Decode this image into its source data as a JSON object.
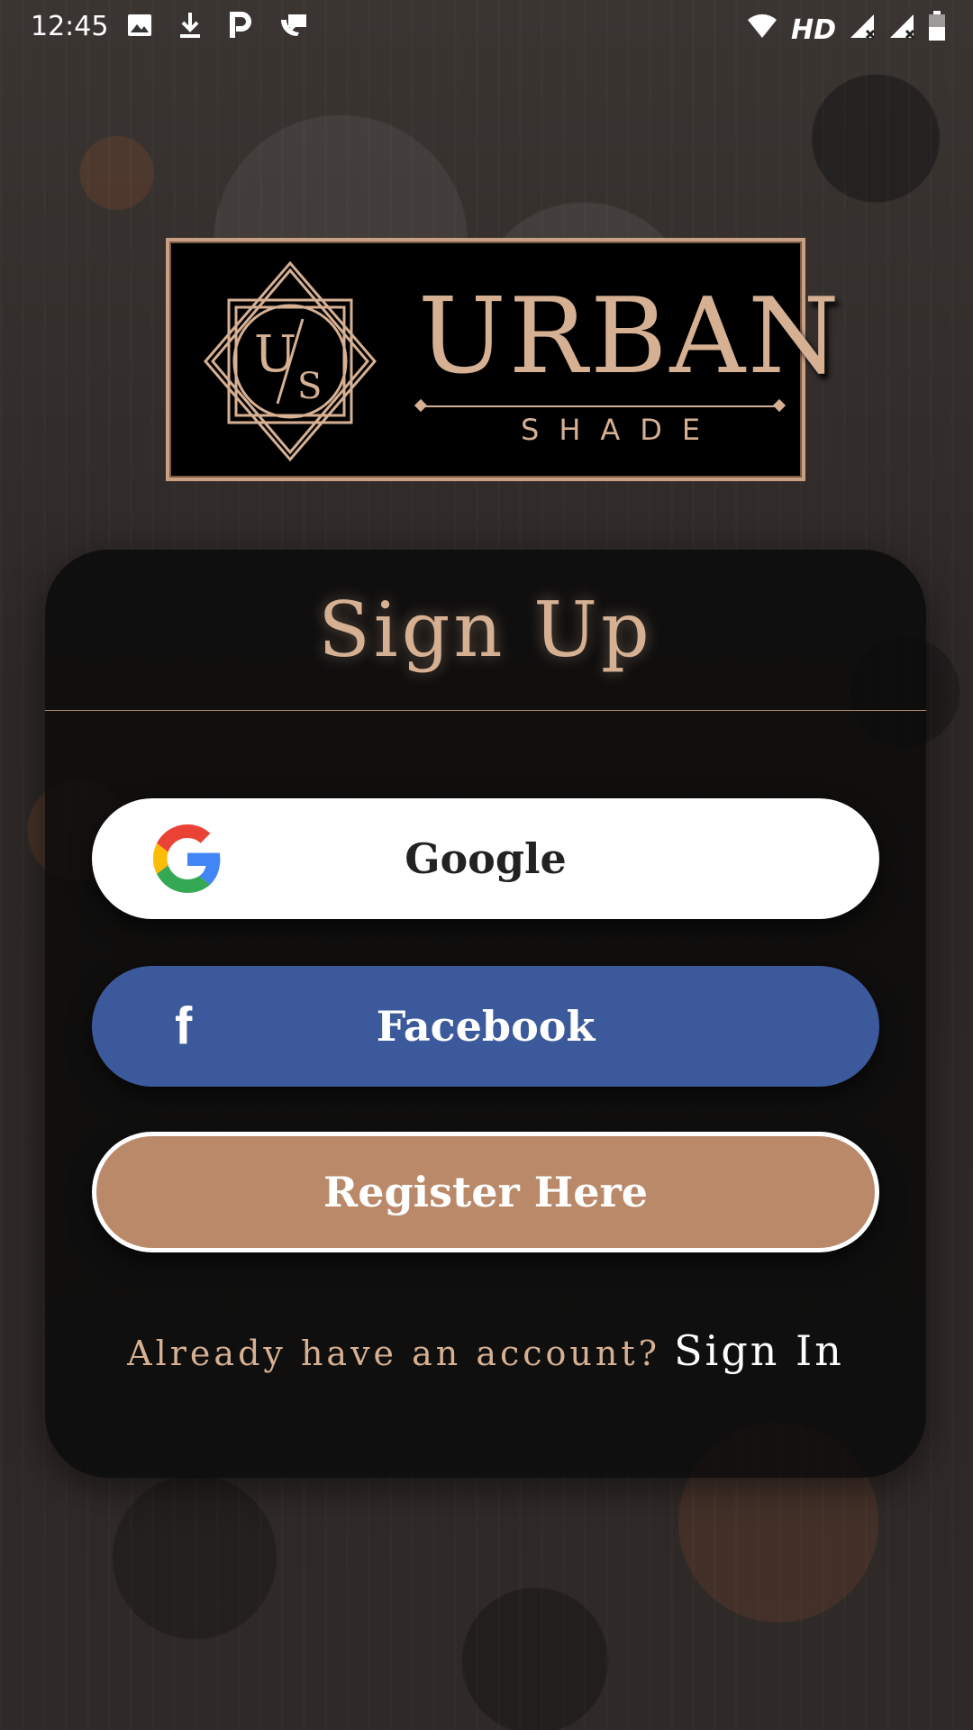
{
  "status_bar": {
    "time": "12:45",
    "network_label": "HD",
    "left_icons": [
      "image-icon",
      "download-icon",
      "parking-icon",
      "chat-bubble-icon"
    ],
    "right_icons": [
      "wifi-icon",
      "signal-icon",
      "signal-icon",
      "battery-icon"
    ]
  },
  "logo": {
    "monogram_left": "U",
    "monogram_right": "S",
    "brand": "URBAN",
    "sub": "SHADE"
  },
  "signup": {
    "title": "Sign Up",
    "google_label": "Google",
    "facebook_label": "Facebook",
    "register_label": "Register Here",
    "prompt": "Already have an account?",
    "signin_link": "Sign In"
  },
  "colors": {
    "accent_gold": "#d6b093",
    "facebook_blue": "#3c5a9b",
    "register_tan": "#b9896a",
    "card_bg": "#0a0a0a"
  }
}
